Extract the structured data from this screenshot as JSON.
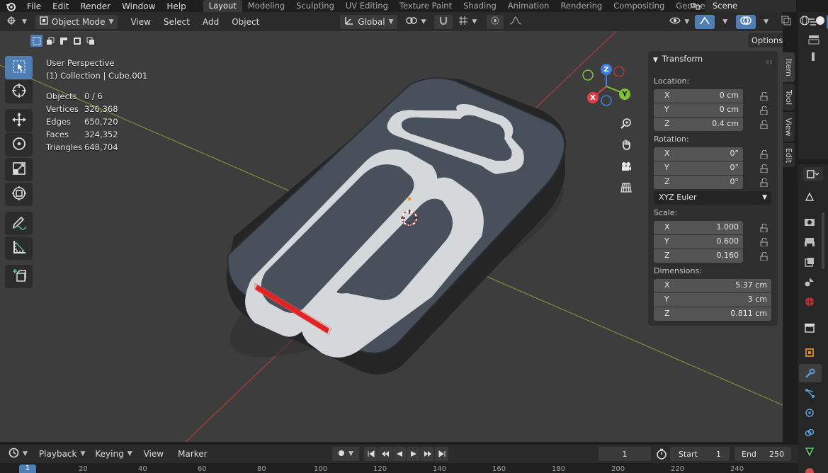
{
  "menubar": {
    "items": [
      "File",
      "Edit",
      "Render",
      "Window",
      "Help"
    ],
    "workspaces": [
      "Layout",
      "Modeling",
      "Sculpting",
      "UV Editing",
      "Texture Paint",
      "Shading",
      "Animation",
      "Rendering",
      "Compositing",
      "Geometry Nod"
    ],
    "active_workspace": "Layout",
    "scene_label": "Scene"
  },
  "viewport_header": {
    "mode": "Object Mode",
    "menus": [
      "View",
      "Select",
      "Add",
      "Object"
    ],
    "orientation": "Global",
    "options_label": "Options"
  },
  "overlay": {
    "perspective": "User Perspective",
    "collection": "(1) Collection | Cube.001",
    "stats": [
      {
        "label": "Objects",
        "value": "0 / 6"
      },
      {
        "label": "Vertices",
        "value": "326,368"
      },
      {
        "label": "Edges",
        "value": "650,720"
      },
      {
        "label": "Faces",
        "value": "324,352"
      },
      {
        "label": "Triangles",
        "value": "648,704"
      }
    ]
  },
  "gizmo": {
    "x": "X",
    "y": "Y",
    "z": "Z"
  },
  "transform_panel": {
    "title": "Transform",
    "location_label": "Location:",
    "location": [
      {
        "axis": "X",
        "value": "0 cm"
      },
      {
        "axis": "Y",
        "value": "0 cm"
      },
      {
        "axis": "Z",
        "value": "0.4 cm"
      }
    ],
    "rotation_label": "Rotation:",
    "rotation": [
      {
        "axis": "X",
        "value": "0°"
      },
      {
        "axis": "Y",
        "value": "0°"
      },
      {
        "axis": "Z",
        "value": "0°"
      }
    ],
    "rotation_mode": "XYZ Euler",
    "scale_label": "Scale:",
    "scale": [
      {
        "axis": "X",
        "value": "1.000"
      },
      {
        "axis": "Y",
        "value": "0.600"
      },
      {
        "axis": "Z",
        "value": "0.160"
      }
    ],
    "dimensions_label": "Dimensions:",
    "dimensions": [
      {
        "axis": "X",
        "value": "5.37 cm"
      },
      {
        "axis": "Y",
        "value": "3 cm"
      },
      {
        "axis": "Z",
        "value": "0.811 cm"
      }
    ]
  },
  "sidebar_tabs": [
    "Item",
    "Tool",
    "View",
    "Edit"
  ],
  "timeline": {
    "menus": [
      "Playback",
      "Keying",
      "View",
      "Marker"
    ],
    "current_frame": "1",
    "start_label": "Start",
    "start_value": "1",
    "end_label": "End",
    "end_value": "250"
  },
  "ruler": {
    "current": "1",
    "ticks": [
      "20",
      "40",
      "60",
      "80",
      "100",
      "120",
      "140",
      "160",
      "180",
      "200",
      "220",
      "240"
    ]
  },
  "colors": {
    "accent": "#4f7eb5",
    "x_axis": "#e0404b",
    "y_axis": "#7fc23a",
    "z_axis": "#3d7fe0",
    "object_dark": "#47505b",
    "object_light": "#d5d8db",
    "indicator_red": "#e02424"
  }
}
